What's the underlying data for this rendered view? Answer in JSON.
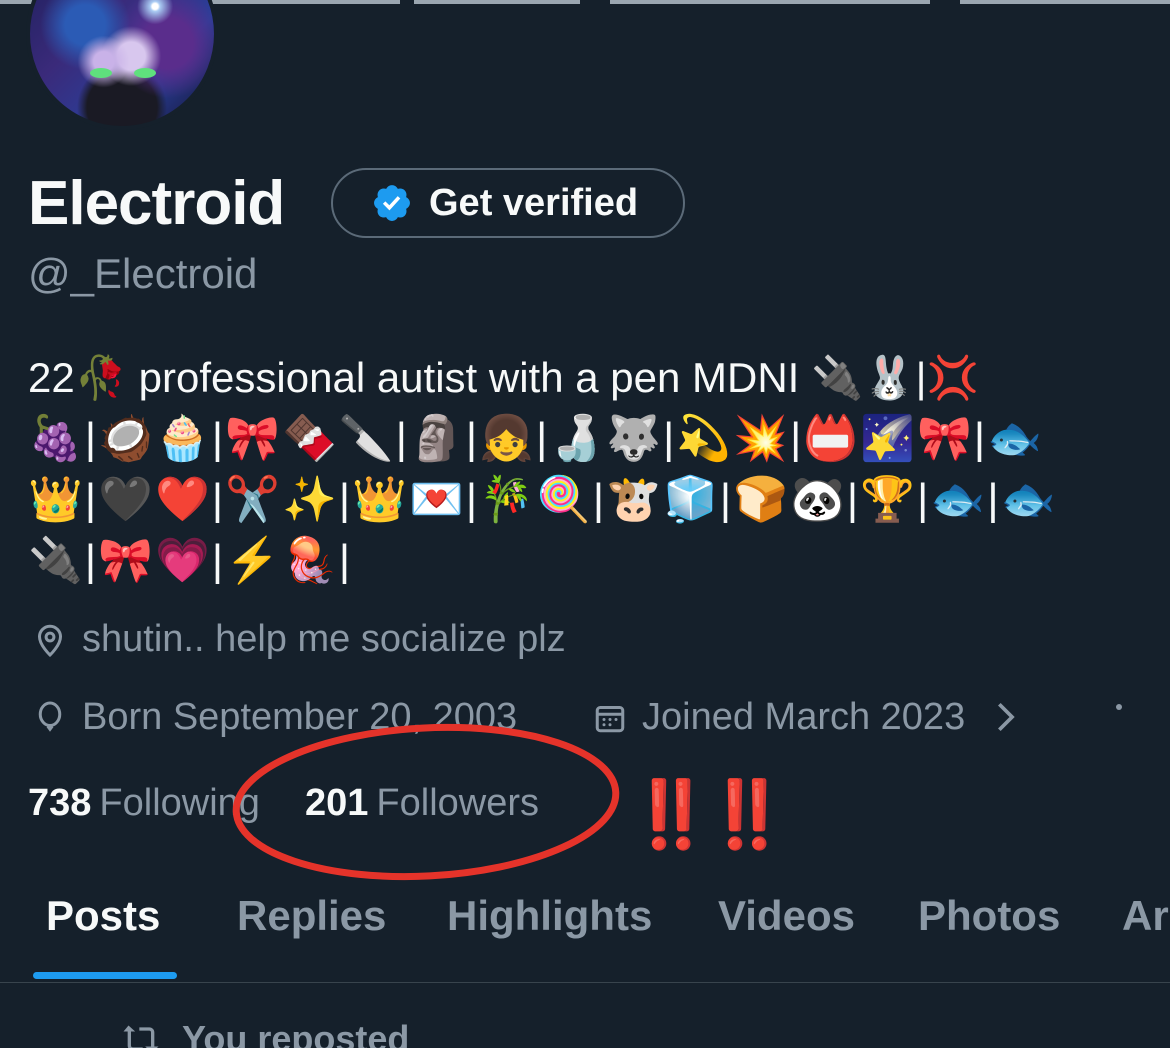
{
  "profile": {
    "display_name": "Electroid",
    "handle": "@_Electroid",
    "verify_button_label": "Get verified",
    "bio_lines": [
      "22🥀 professional autist with a pen MDNI 🔌🐰|💢",
      "🍇|🥥🧁|🎀🍫🔪|🗿|👧|🍶🐺|💫💥|📛🌠🎀|🐟",
      "👑|🖤❤️|✂️✨|👑💌|🎋🍭|🐮🧊|🍞🐼|🏆|🐟|🐟",
      "🔌|🎀💗|⚡🪼|"
    ],
    "location": "shutin.. help me socialize plz",
    "birthday": "Born September 20, 2003",
    "joined": "Joined March 2023",
    "following_count": "738",
    "following_label": "Following",
    "followers_count": "201",
    "followers_label": "Followers"
  },
  "annotation": {
    "exclamations": "‼️‼️",
    "color": "#e5332a"
  },
  "tabs": [
    {
      "label": "Posts",
      "active": true
    },
    {
      "label": "Replies",
      "active": false
    },
    {
      "label": "Highlights",
      "active": false
    },
    {
      "label": "Videos",
      "active": false
    },
    {
      "label": "Photos",
      "active": false
    },
    {
      "label": "Ar",
      "active": false
    }
  ],
  "feed": {
    "repost_text": "You reposted"
  },
  "colors": {
    "background": "#15202b",
    "accent": "#1d9bf0",
    "secondary_text": "#8b98a5",
    "primary_text": "#f7f9f9"
  },
  "icons": {
    "verified": "verified-badge-icon",
    "location": "location-pin-icon",
    "birthday": "balloon-icon",
    "joined": "calendar-icon",
    "chevron": "chevron-right-icon",
    "repost": "repost-icon"
  }
}
